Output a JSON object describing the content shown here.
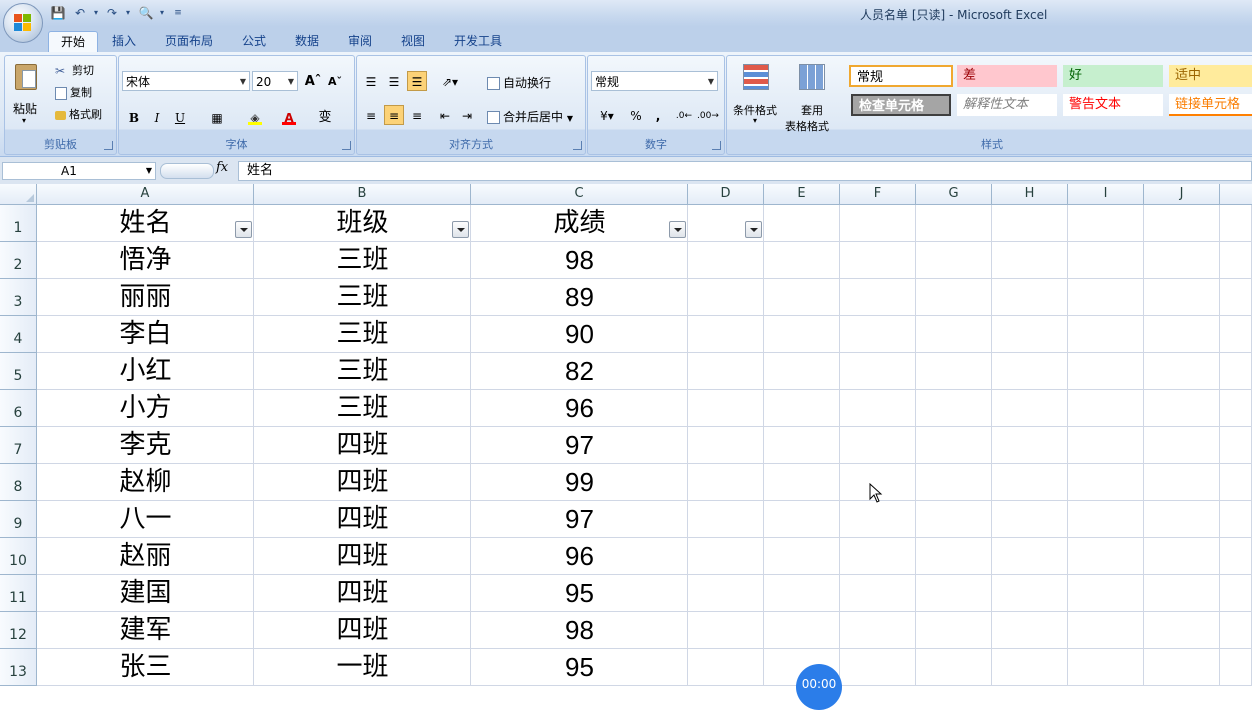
{
  "window": {
    "title": "人员名单  [只读] - Microsoft Excel"
  },
  "tabs": [
    {
      "label": "开始",
      "active": true
    },
    {
      "label": "插入"
    },
    {
      "label": "页面布局"
    },
    {
      "label": "公式"
    },
    {
      "label": "数据"
    },
    {
      "label": "审阅"
    },
    {
      "label": "视图"
    },
    {
      "label": "开发工具"
    }
  ],
  "ribbon": {
    "clipboard": {
      "label": "剪贴板",
      "paste": "粘贴",
      "cut": "剪切",
      "copy": "复制",
      "format_painter": "格式刷"
    },
    "font": {
      "label": "字体",
      "name": "宋体",
      "size": "20",
      "bold": "B",
      "italic": "I",
      "underline": "U",
      "font_color": "A",
      "phonetic": "变"
    },
    "alignment": {
      "label": "对齐方式",
      "wrap": "自动换行",
      "merge": "合并后居中"
    },
    "number": {
      "label": "数字",
      "format": "常规",
      "percent": "%",
      "comma": ","
    },
    "styles": {
      "label": "样式",
      "conditional": "条件格式",
      "table_format_1": "套用",
      "table_format_2": "表格格式",
      "cells": [
        "常规",
        "差",
        "好",
        "适中",
        "检查单元格",
        "解释性文本",
        "警告文本",
        "链接单元格"
      ]
    }
  },
  "formula_bar": {
    "name_box": "A1",
    "fx": "fx",
    "content": "姓名"
  },
  "columns": [
    "A",
    "B",
    "C",
    "D",
    "E",
    "F",
    "G",
    "H",
    "I",
    "J"
  ],
  "rows": [
    "1",
    "2",
    "3",
    "4",
    "5",
    "6",
    "7",
    "8",
    "9",
    "10",
    "11",
    "12",
    "13"
  ],
  "table": {
    "headers": [
      "姓名",
      "班级",
      "成绩"
    ],
    "data": [
      [
        "悟净",
        "三班",
        "98"
      ],
      [
        "丽丽",
        "三班",
        "89"
      ],
      [
        "李白",
        "三班",
        "90"
      ],
      [
        "小红",
        "三班",
        "82"
      ],
      [
        "小方",
        "三班",
        "96"
      ],
      [
        "李克",
        "四班",
        "97"
      ],
      [
        "赵柳",
        "四班",
        "99"
      ],
      [
        "八一",
        "四班",
        "97"
      ],
      [
        "赵丽",
        "四班",
        "96"
      ],
      [
        "建国",
        "四班",
        "95"
      ],
      [
        "建军",
        "四班",
        "98"
      ],
      [
        "张三",
        "一班",
        "95"
      ]
    ]
  },
  "recorder_badge": "00:00",
  "colors": {
    "ribbon_blue": "#dae6f4",
    "accent": "#15428b",
    "grid": "#d0d7e5",
    "bad": "#ffc7ce",
    "good": "#c6efce",
    "neutral": "#ffeb9c"
  }
}
